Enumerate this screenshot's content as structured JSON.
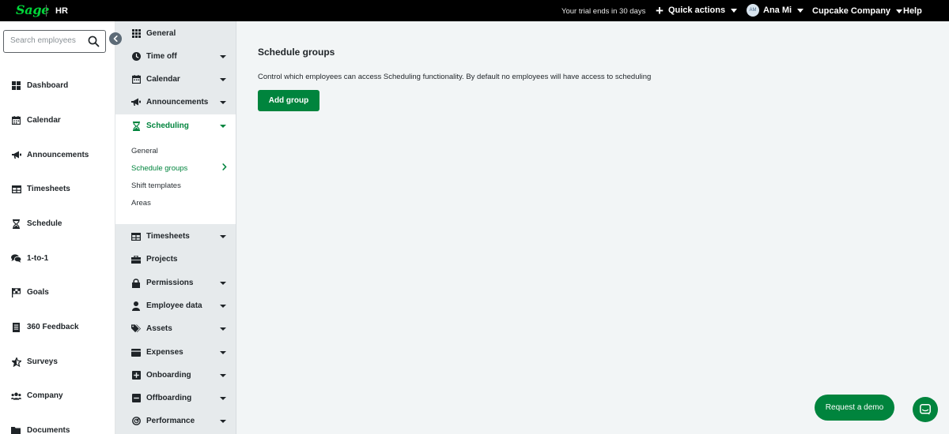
{
  "topbar": {
    "logo": "Sage",
    "app_name": "HR",
    "trial_text": "Your trial ends in 30 days",
    "quick_actions": "Quick actions",
    "user_initials": "AM",
    "user_name": "Ana Mi",
    "company": "Cupcake Company",
    "help": "Help"
  },
  "search": {
    "placeholder": "Search employees"
  },
  "leftnav": {
    "items": [
      {
        "label": "Dashboard",
        "icon": "grid-icon"
      },
      {
        "label": "Calendar",
        "icon": "calendar-icon"
      },
      {
        "label": "Announcements",
        "icon": "megaphone-icon"
      },
      {
        "label": "Timesheets",
        "icon": "table-icon"
      },
      {
        "label": "Schedule",
        "icon": "hourglass-icon"
      },
      {
        "label": "1-to-1",
        "icon": "chat-bubbles-icon"
      },
      {
        "label": "Goals",
        "icon": "flag-icon"
      },
      {
        "label": "360 Feedback",
        "icon": "document-icon"
      },
      {
        "label": "Surveys",
        "icon": "star-icon"
      },
      {
        "label": "Company",
        "icon": "people-icon"
      },
      {
        "label": "Documents",
        "icon": "folder-icon"
      }
    ]
  },
  "settings_nav": {
    "items": [
      {
        "label": "General",
        "icon": "grid-icon"
      },
      {
        "label": "Time off",
        "icon": "clock-icon"
      },
      {
        "label": "Calendar",
        "icon": "calendar-icon"
      },
      {
        "label": "Announcements",
        "icon": "megaphone-icon"
      },
      {
        "label": "Scheduling",
        "icon": "hourglass-icon"
      },
      {
        "label": "Timesheets",
        "icon": "table-icon"
      },
      {
        "label": "Projects",
        "icon": "briefcase-icon"
      },
      {
        "label": "Permissions",
        "icon": "lock-icon"
      },
      {
        "label": "Employee data",
        "icon": "person-icon"
      },
      {
        "label": "Assets",
        "icon": "tags-icon"
      },
      {
        "label": "Expenses",
        "icon": "wallet-icon"
      },
      {
        "label": "Onboarding",
        "icon": "plus-square-icon"
      },
      {
        "label": "Offboarding",
        "icon": "minus-square-icon"
      },
      {
        "label": "Performance",
        "icon": "gauge-icon"
      }
    ],
    "scheduling_sub": [
      "General",
      "Schedule groups",
      "Shift templates",
      "Areas"
    ]
  },
  "main": {
    "title": "Schedule groups",
    "description": "Control which employees can access Scheduling functionality. By default no employees will have access to scheduling",
    "add_button": "Add group"
  },
  "footer": {
    "demo_button": "Request a demo"
  },
  "colors": {
    "accent": "#00843d",
    "brand": "#00d639",
    "topbar": "#000000"
  }
}
